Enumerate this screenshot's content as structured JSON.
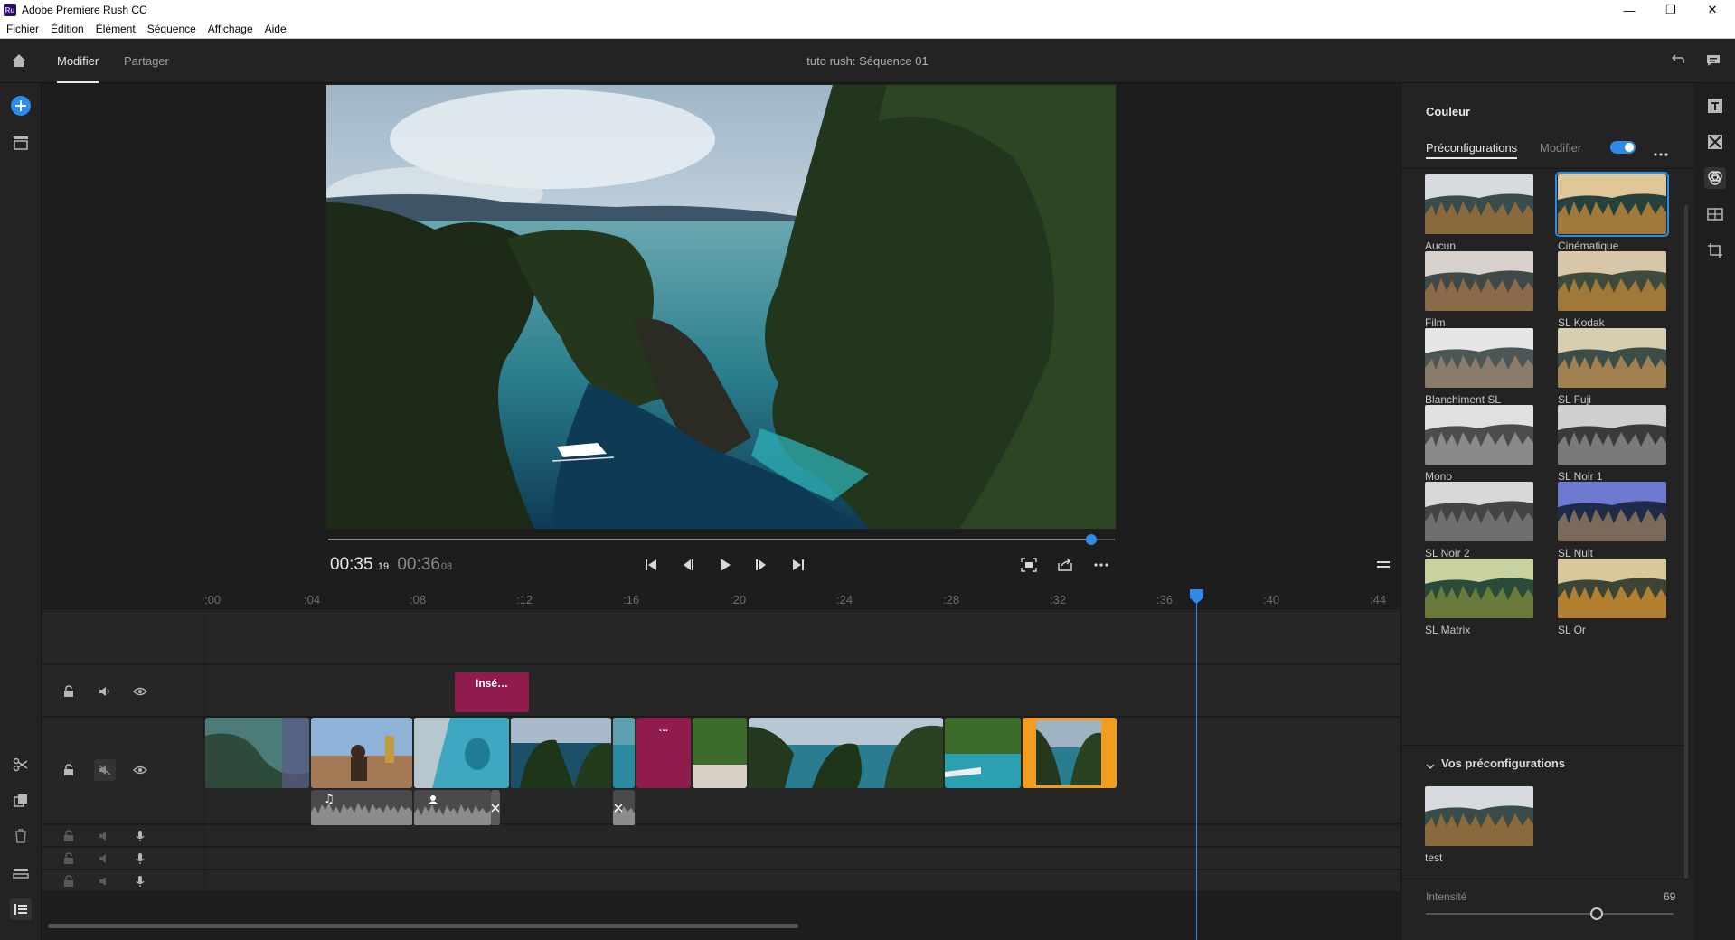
{
  "window": {
    "app_title": "Adobe Premiere Rush CC",
    "app_icon": "Ru",
    "minimize": "—",
    "restore": "❐",
    "close": "✕"
  },
  "menu": [
    "Fichier",
    "Édition",
    "Élément",
    "Séquence",
    "Affichage",
    "Aide"
  ],
  "header": {
    "tabs": [
      "Modifier",
      "Partager"
    ],
    "active_tab": "Modifier",
    "sequence_title": "tuto rush: Séquence  01"
  },
  "player": {
    "current": "00:35",
    "current_frames": "19",
    "duration": "00:36",
    "duration_frames": "08",
    "progress": 0.97
  },
  "timeline": {
    "ticks": [
      ":00",
      ":04",
      ":08",
      ":12",
      ":16",
      ":20",
      ":24",
      ":28",
      ":32",
      ":36",
      ":40",
      ":44"
    ],
    "title_clip": "Insé…",
    "small_title_clip": "…"
  },
  "color_panel": {
    "title": "Couleur",
    "tabs": [
      "Préconfigurations",
      "Modifier"
    ],
    "presets": [
      {
        "label": "Aucun",
        "style": "normal"
      },
      {
        "label": "Cinématique",
        "style": "cine",
        "selected": true
      },
      {
        "label": "Film",
        "style": "film"
      },
      {
        "label": "SL Kodak",
        "style": "warm"
      },
      {
        "label": "Blanchiment SL",
        "style": "bleach"
      },
      {
        "label": "SL Fuji",
        "style": "fuji"
      },
      {
        "label": "Mono",
        "style": "mono"
      },
      {
        "label": "SL Noir 1",
        "style": "mono2"
      },
      {
        "label": "SL Noir 2",
        "style": "mono3"
      },
      {
        "label": "SL Nuit",
        "style": "night"
      },
      {
        "label": "SL Matrix",
        "style": "matrix"
      },
      {
        "label": "SL Or",
        "style": "gold"
      }
    ],
    "my_presets_title": "Vos préconfigurations",
    "my_presets": [
      {
        "label": "test",
        "style": "normal"
      }
    ],
    "intensity_label": "Intensité",
    "intensity_value": "69"
  },
  "colors": {
    "accent": "#2d8ceb",
    "title_clip": "#8f1c4c",
    "selected_clip": "#f39c1f"
  }
}
